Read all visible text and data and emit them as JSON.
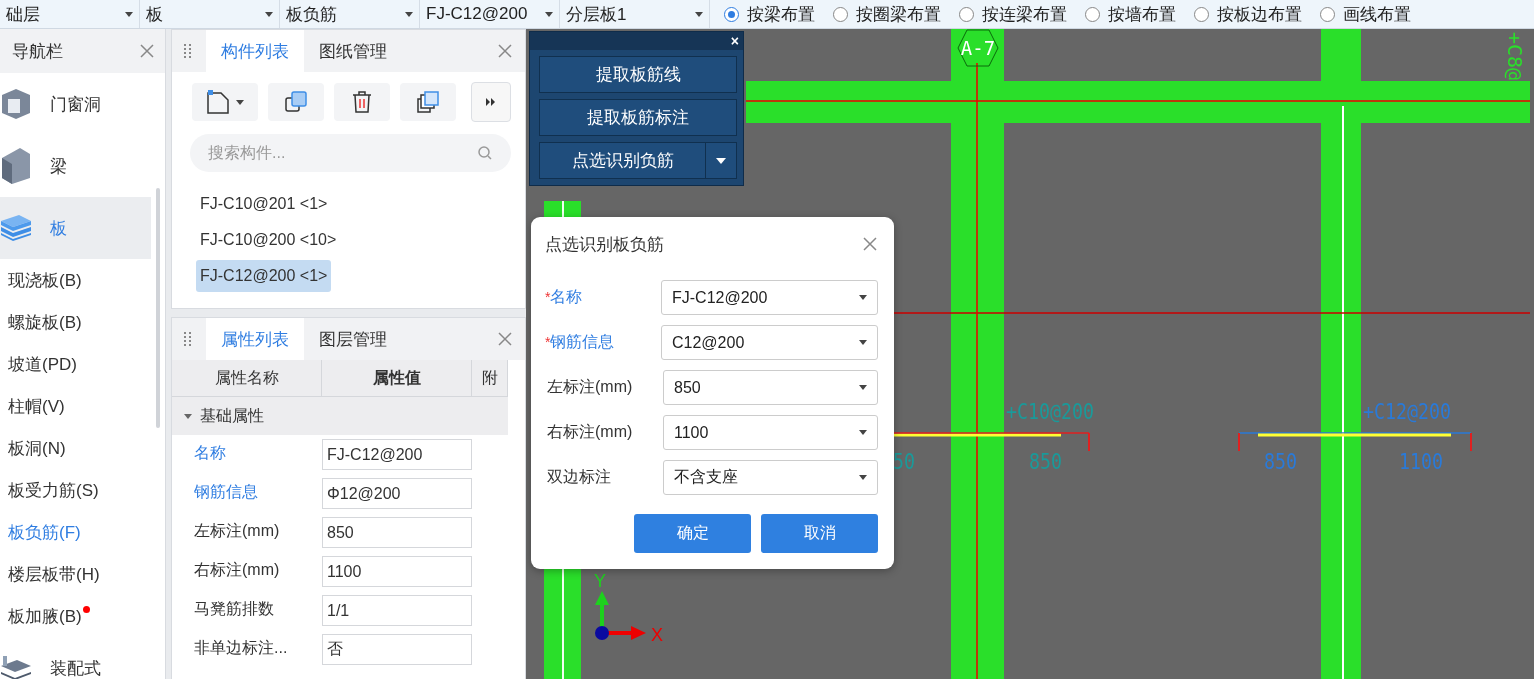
{
  "toolbar": {
    "dropdowns": [
      "础层",
      "板",
      "板负筋",
      "FJ-C12@200",
      "分层板1"
    ],
    "radios": [
      {
        "label": "按梁布置",
        "selected": true
      },
      {
        "label": "按圈梁布置",
        "selected": false
      },
      {
        "label": "按连梁布置",
        "selected": false
      },
      {
        "label": "按墙布置",
        "selected": false
      },
      {
        "label": "按板边布置",
        "selected": false
      },
      {
        "label": "画线布置",
        "selected": false
      }
    ]
  },
  "nav": {
    "title": "导航栏",
    "items": [
      {
        "label": "门窗洞",
        "selected": false
      },
      {
        "label": "梁",
        "selected": false
      },
      {
        "label": "板",
        "selected": true,
        "children": [
          {
            "label": "现浇板(B)",
            "selected": false,
            "new": false
          },
          {
            "label": "螺旋板(B)",
            "selected": false,
            "new": false
          },
          {
            "label": "坡道(PD)",
            "selected": false,
            "new": false
          },
          {
            "label": "柱帽(V)",
            "selected": false,
            "new": false
          },
          {
            "label": "板洞(N)",
            "selected": false,
            "new": false
          },
          {
            "label": "板受力筋(S)",
            "selected": false,
            "new": false
          },
          {
            "label": "板负筋(F)",
            "selected": true,
            "new": false
          },
          {
            "label": "楼层板带(H)",
            "selected": false,
            "new": false
          },
          {
            "label": "板加腋(B)",
            "selected": false,
            "new": true
          }
        ]
      },
      {
        "label": "装配式",
        "selected": false
      }
    ]
  },
  "components": {
    "tabs": [
      {
        "label": "构件列表",
        "selected": true
      },
      {
        "label": "图纸管理",
        "selected": false
      }
    ],
    "search": {
      "placeholder": "搜索构件..."
    },
    "items": [
      {
        "label": "FJ-C10@201 <1>",
        "selected": false
      },
      {
        "label": "FJ-C10@200 <10>",
        "selected": false
      },
      {
        "label": "FJ-C12@200 <1>",
        "selected": true
      }
    ]
  },
  "properties": {
    "tabs": [
      {
        "label": "属性列表",
        "selected": true
      },
      {
        "label": "图层管理",
        "selected": false
      }
    ],
    "columns": [
      "属性名称",
      "属性值",
      "附"
    ],
    "group": {
      "label": "基础属性",
      "expanded": true
    },
    "rows": [
      {
        "name": "名称",
        "value": "FJ-C12@200",
        "highlighted": true
      },
      {
        "name": "钢筋信息",
        "value": "Φ12@200",
        "highlighted": true
      },
      {
        "name": "左标注(mm)",
        "value": "850",
        "highlighted": false
      },
      {
        "name": "右标注(mm)",
        "value": "1100",
        "highlighted": false
      },
      {
        "name": "马凳筋排数",
        "value": "1/1",
        "highlighted": false
      },
      {
        "name": "非单边标注...",
        "value": "否",
        "highlighted": false
      }
    ]
  },
  "tool_panel": {
    "close": "×",
    "buttons": [
      {
        "label": "提取板筋线",
        "kind": "plain"
      },
      {
        "label": "提取板筋标注",
        "kind": "plain"
      },
      {
        "label": "点选识别负筋",
        "kind": "split"
      }
    ]
  },
  "canvas": {
    "grid_label": "A-7",
    "axis_x": "X",
    "axis_y": "Y",
    "labels": [
      {
        "text": "+C8@",
        "color": "#2adf2a"
      },
      {
        "text": "+C10@200",
        "color": "#1a9a9a"
      },
      {
        "text": "+C12@200",
        "color": "#2a7ad8"
      },
      {
        "text": "50",
        "color": "#1a9a9a"
      },
      {
        "text": "850",
        "color": "#1a9a9a"
      },
      {
        "text": "850",
        "color": "#2a7ad8"
      },
      {
        "text": "1100",
        "color": "#2a7ad8"
      }
    ]
  },
  "dialog": {
    "title": "点选识别板负筋",
    "required_mark": "*",
    "fields": [
      {
        "label": "名称",
        "value": "FJ-C12@200",
        "required": true
      },
      {
        "label": "钢筋信息",
        "value": "C12@200",
        "required": true
      },
      {
        "label": "左标注(mm)",
        "value": "850",
        "required": false
      },
      {
        "label": "右标注(mm)",
        "value": "1100",
        "required": false
      },
      {
        "label": "双边标注",
        "value": "不含支座",
        "required": false
      }
    ],
    "buttons": [
      "确定",
      "取消"
    ]
  }
}
